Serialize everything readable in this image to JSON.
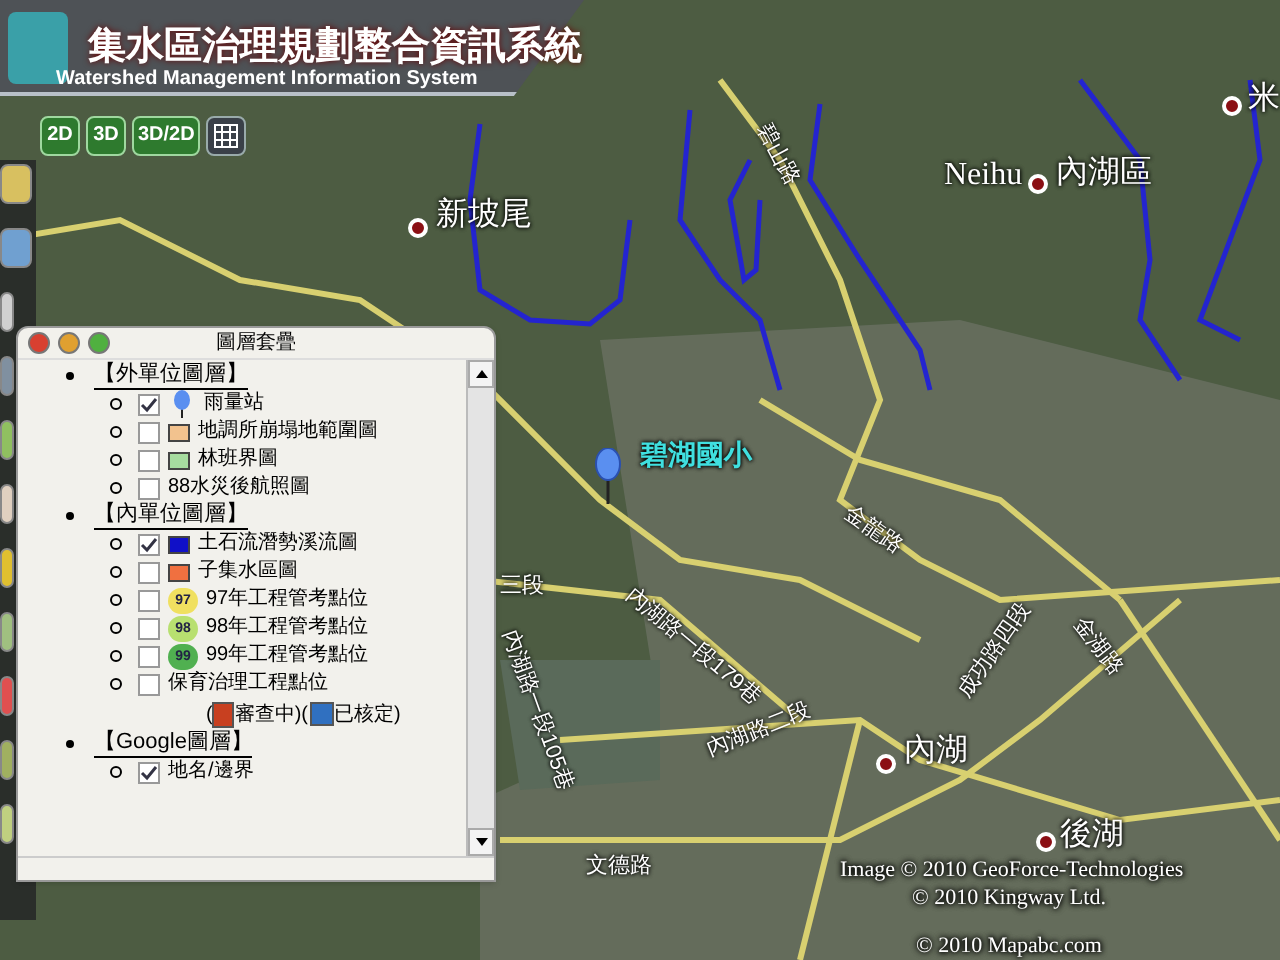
{
  "header": {
    "title": "集水區治理規劃整合資訊系統",
    "subtitle": "Watershed Management Information System",
    "view_buttons": [
      "2D",
      "3D",
      "3D/2D"
    ]
  },
  "map": {
    "labels": [
      {
        "text": "新坡尾",
        "kind": "place"
      },
      {
        "text": "碧山路",
        "kind": "road"
      },
      {
        "text": "Neihu",
        "kind": "english"
      },
      {
        "text": "內湖區",
        "kind": "place"
      },
      {
        "text": "米",
        "kind": "place"
      },
      {
        "text": "碧湖國小",
        "kind": "poi"
      },
      {
        "text": "金龍路",
        "kind": "road"
      },
      {
        "text": "三段",
        "kind": "road"
      },
      {
        "text": "內湖路一段179巷",
        "kind": "road"
      },
      {
        "text": "內湖路一段105巷",
        "kind": "road"
      },
      {
        "text": "內湖路二段",
        "kind": "road"
      },
      {
        "text": "成功路四段",
        "kind": "road"
      },
      {
        "text": "金湖路",
        "kind": "road"
      },
      {
        "text": "內湖",
        "kind": "place"
      },
      {
        "text": "後湖",
        "kind": "place"
      },
      {
        "text": "文德路",
        "kind": "road"
      }
    ],
    "credits": [
      "Image © 2010 GeoForce-Technologies",
      "© 2010 Kingway Ltd.",
      "© 2010 Mapabc.com"
    ]
  },
  "layer_panel": {
    "title": "圖層套疊",
    "groups": [
      {
        "label": "【外單位圖層】",
        "layers": [
          {
            "label": "雨量站",
            "checked": true,
            "kind": "pin"
          },
          {
            "label": "地調所崩塌地範圍圖",
            "checked": false,
            "kind": "swatch",
            "color": "#f2c28e"
          },
          {
            "label": "林班界圖",
            "checked": false,
            "kind": "swatch",
            "color": "#a6dca0"
          },
          {
            "label": "88水災後航照圖",
            "checked": false,
            "kind": "plain"
          }
        ]
      },
      {
        "label": "【內單位圖層】",
        "layers": [
          {
            "label": "土石流潛勢溪流圖",
            "checked": true,
            "kind": "swatch",
            "color": "#1010c8"
          },
          {
            "label": "子集水區圖",
            "checked": false,
            "kind": "swatch",
            "color": "#f07040"
          },
          {
            "label": "97年工程管考點位",
            "checked": false,
            "kind": "badge",
            "badge": "97",
            "color": "#f0e060"
          },
          {
            "label": "98年工程管考點位",
            "checked": false,
            "kind": "badge",
            "badge": "98",
            "color": "#b8e070"
          },
          {
            "label": "99年工程管考點位",
            "checked": false,
            "kind": "badge",
            "badge": "99",
            "color": "#50b050"
          },
          {
            "label": "保育治理工程點位",
            "checked": false,
            "kind": "plain"
          }
        ],
        "legend": [
          "(",
          "審查中",
          ")(",
          "已核定",
          ")"
        ]
      },
      {
        "label": "【Google圖層】",
        "layers": [
          {
            "label": "地名/邊界",
            "checked": true,
            "kind": "plain"
          }
        ]
      }
    ]
  }
}
